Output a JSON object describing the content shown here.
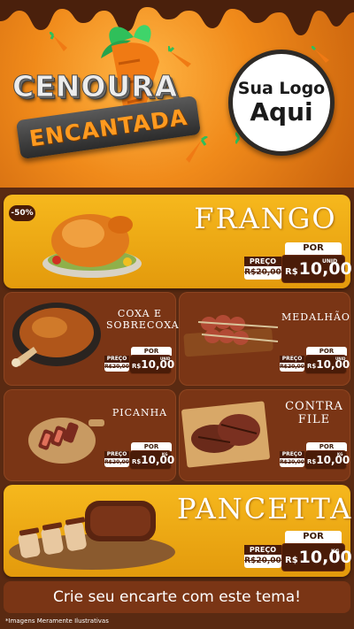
{
  "header": {
    "title_line1": "CENOURA",
    "title_line2": "ENCANTADA",
    "logo_line1": "Sua Logo",
    "logo_line2": "Aqui"
  },
  "colors": {
    "accent_orange": "#f08a1a",
    "card_yellow": "#f6b81d",
    "card_brown": "#7a3515",
    "dark_brown": "#4a1c08"
  },
  "products": {
    "frango": {
      "badge": "-50%",
      "name": "FRANGO",
      "por_label": "POR",
      "preco_label": "PREÇO",
      "old_price": "R$20,00",
      "currency": "R$",
      "price": "10,00",
      "unit": "UNID"
    },
    "coxa": {
      "name_line1": "COXA E",
      "name_line2": "SOBRECOXA",
      "por_label": "POR",
      "preco_label": "PREÇO",
      "old_price": "R$20,00",
      "currency": "R$",
      "price": "10,00",
      "unit": "UNID"
    },
    "medalhao": {
      "name": "MEDALHÃO",
      "por_label": "POR",
      "preco_label": "PREÇO",
      "old_price": "R$20,00",
      "currency": "R$",
      "price": "10,00",
      "unit": "UNID"
    },
    "picanha": {
      "name": "PICANHA",
      "por_label": "POR",
      "preco_label": "PREÇO",
      "old_price": "R$20,00",
      "currency": "R$",
      "price": "10,00",
      "unit": "KG"
    },
    "contrafile": {
      "name_line1": "CONTRA",
      "name_line2": "FILE",
      "por_label": "POR",
      "preco_label": "PREÇO",
      "old_price": "R$20,00",
      "currency": "R$",
      "price": "10,00",
      "unit": "KG"
    },
    "pancetta": {
      "name": "PANCETTA",
      "por_label": "POR",
      "preco_label": "PREÇO",
      "old_price": "R$20,00",
      "currency": "R$",
      "price": "10,00",
      "unit": "KG"
    }
  },
  "footer": {
    "cta": "Crie seu encarte com este tema!",
    "disclaimer": "*Imagens Meramente Ilustrativas"
  }
}
